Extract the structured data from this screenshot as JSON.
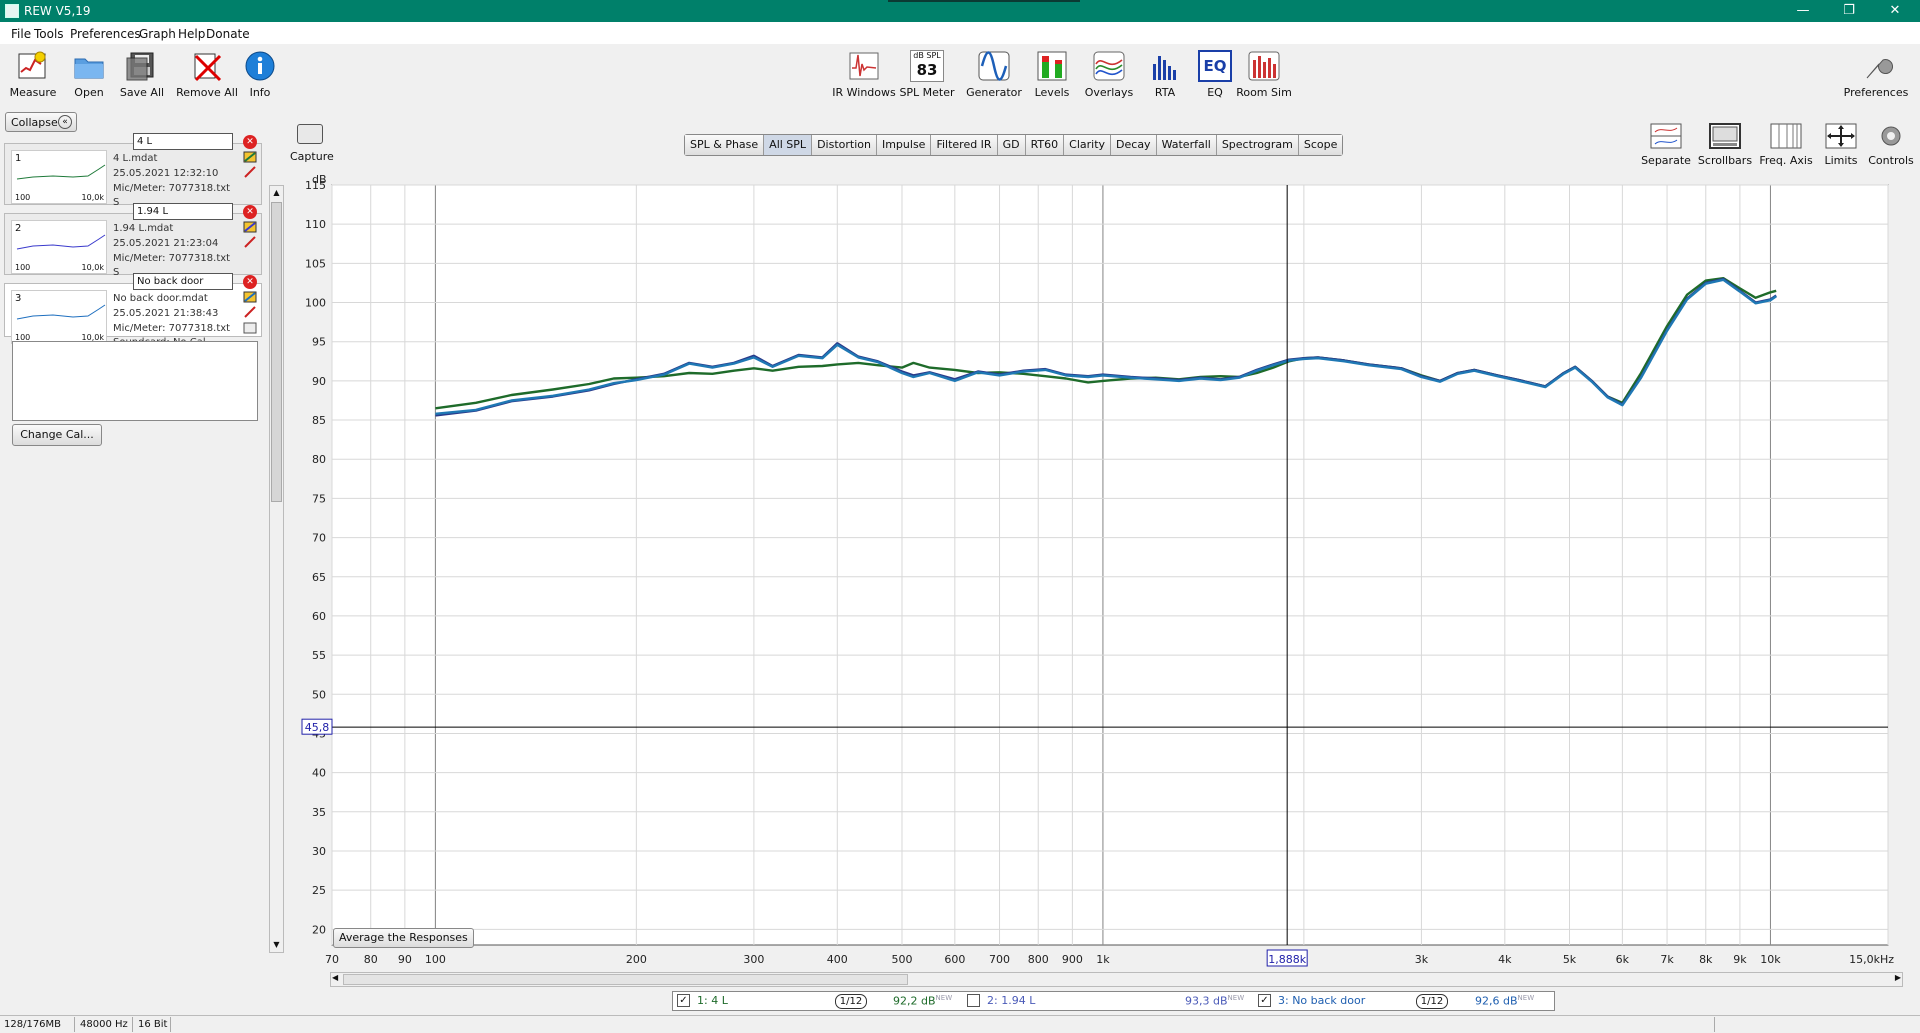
{
  "window": {
    "title": "REW V5,19"
  },
  "menu": [
    "File",
    "Tools",
    "Preferences",
    "Graph",
    "Help",
    "Donate"
  ],
  "toolbar": {
    "left": [
      {
        "label": "Measure",
        "icon": "measure-icon"
      },
      {
        "label": "Open",
        "icon": "folder-icon"
      },
      {
        "label": "Save All",
        "icon": "floppy-icon"
      },
      {
        "label": "Remove All",
        "icon": "remove-all-icon"
      },
      {
        "label": "Info",
        "icon": "info-icon"
      }
    ],
    "center": [
      {
        "label": "IR Windows",
        "icon": "ir-windows-icon"
      },
      {
        "label": "SPL Meter",
        "icon": "spl-meter-icon",
        "top_text": "dB SPL",
        "value": "83"
      },
      {
        "label": "Generator",
        "icon": "generator-icon"
      },
      {
        "label": "Levels",
        "icon": "levels-icon"
      },
      {
        "label": "Overlays",
        "icon": "overlays-icon"
      },
      {
        "label": "RTA",
        "icon": "rta-icon"
      },
      {
        "label": "EQ",
        "icon": "eq-icon",
        "text": "EQ"
      },
      {
        "label": "Room Sim",
        "icon": "room-sim-icon"
      }
    ],
    "right": {
      "label": "Preferences",
      "icon": "wrench-icon"
    }
  },
  "left_panel": {
    "collapse_label": "Collapse",
    "measurements": [
      {
        "num": "1",
        "name": "4 L",
        "file": "4 L.mdat",
        "date": "25.05.2021 12:32:10",
        "mic": "Mic/Meter: 7077318.txt",
        "soundcard": "S",
        "color": "#1f7a3a",
        "thumb_low": "100",
        "thumb_high": "10,0k"
      },
      {
        "num": "2",
        "name": "1.94 L",
        "file": "1.94 L.mdat",
        "date": "25.05.2021 21:23:04",
        "mic": "Mic/Meter: 7077318.txt",
        "soundcard": "S",
        "color": "#3a3acc",
        "thumb_low": "100",
        "thumb_high": "10,0k"
      },
      {
        "num": "3",
        "name": "No back door",
        "file": "No back door.mdat",
        "date": "25.05.2021 21:38:43",
        "mic": "Mic/Meter: 7077318.txt",
        "soundcard": "Soundcard: No Cal",
        "color": "#1e6fbf",
        "thumb_low": "100",
        "thumb_high": "10,0k"
      }
    ],
    "change_cal_label": "Change Cal..."
  },
  "graph_toolbar": {
    "capture_label": "Capture",
    "tabs": [
      "SPL & Phase",
      "All SPL",
      "Distortion",
      "Impulse",
      "Filtered IR",
      "GD",
      "RT60",
      "Clarity",
      "Decay",
      "Waterfall",
      "Spectrogram",
      "Scope"
    ],
    "active_tab": "All SPL",
    "right_buttons": [
      {
        "label": "Separate",
        "icon": "separate-icon"
      },
      {
        "label": "Scrollbars",
        "icon": "scrollbars-icon"
      },
      {
        "label": "Freq. Axis",
        "icon": "freq-axis-icon"
      },
      {
        "label": "Limits",
        "icon": "limits-icon"
      },
      {
        "label": "Controls",
        "icon": "gear-icon"
      }
    ]
  },
  "chart_data": {
    "type": "line",
    "ylabel": "dB",
    "xlabel": "",
    "x_unit_label": "Hz",
    "x_scale": "log",
    "xlim": [
      70,
      15000
    ],
    "ylim": [
      18,
      115
    ],
    "y_ticks": [
      20,
      25,
      30,
      35,
      40,
      45,
      50,
      55,
      60,
      65,
      70,
      75,
      80,
      85,
      90,
      95,
      100,
      105,
      110,
      115
    ],
    "x_ticks": [
      {
        "v": 70,
        "label": "70"
      },
      {
        "v": 80,
        "label": "80"
      },
      {
        "v": 90,
        "label": "90"
      },
      {
        "v": 100,
        "label": "100"
      },
      {
        "v": 200,
        "label": "200"
      },
      {
        "v": 300,
        "label": "300"
      },
      {
        "v": 400,
        "label": "400"
      },
      {
        "v": 500,
        "label": "500"
      },
      {
        "v": 600,
        "label": "600"
      },
      {
        "v": 700,
        "label": "700"
      },
      {
        "v": 800,
        "label": "800"
      },
      {
        "v": 900,
        "label": "900"
      },
      {
        "v": 1000,
        "label": "1k"
      },
      {
        "v": 3000,
        "label": "3k"
      },
      {
        "v": 4000,
        "label": "4k"
      },
      {
        "v": 5000,
        "label": "5k"
      },
      {
        "v": 6000,
        "label": "6k"
      },
      {
        "v": 7000,
        "label": "7k"
      },
      {
        "v": 8000,
        "label": "8k"
      },
      {
        "v": 9000,
        "label": "9k"
      },
      {
        "v": 10000,
        "label": "10k"
      },
      {
        "v": 15000,
        "label": "15,0kHz"
      }
    ],
    "cursor": {
      "x": 1888,
      "y": 45.8,
      "x_label": "1,888k",
      "y_label": "45,8"
    },
    "grid": true,
    "series": [
      {
        "name": "4 L",
        "color": "#1e6b2a",
        "points": [
          [
            100,
            86.5
          ],
          [
            115,
            87.2
          ],
          [
            130,
            88.2
          ],
          [
            150,
            88.9
          ],
          [
            170,
            89.6
          ],
          [
            185,
            90.3
          ],
          [
            200,
            90.4
          ],
          [
            220,
            90.6
          ],
          [
            240,
            91.0
          ],
          [
            260,
            90.9
          ],
          [
            280,
            91.3
          ],
          [
            300,
            91.6
          ],
          [
            320,
            91.3
          ],
          [
            350,
            91.8
          ],
          [
            380,
            91.9
          ],
          [
            400,
            92.1
          ],
          [
            430,
            92.3
          ],
          [
            460,
            92.0
          ],
          [
            500,
            91.7
          ],
          [
            520,
            92.3
          ],
          [
            550,
            91.7
          ],
          [
            600,
            91.4
          ],
          [
            650,
            91.0
          ],
          [
            700,
            91.1
          ],
          [
            760,
            90.9
          ],
          [
            820,
            90.6
          ],
          [
            880,
            90.3
          ],
          [
            950,
            89.8
          ],
          [
            1000,
            90.0
          ],
          [
            1100,
            90.3
          ],
          [
            1200,
            90.4
          ],
          [
            1300,
            90.2
          ],
          [
            1400,
            90.5
          ],
          [
            1500,
            90.6
          ],
          [
            1600,
            90.5
          ],
          [
            1700,
            91.0
          ],
          [
            1800,
            91.7
          ],
          [
            1900,
            92.5
          ],
          [
            2000,
            92.9
          ],
          [
            2100,
            93.0
          ],
          [
            2300,
            92.6
          ],
          [
            2500,
            92.1
          ],
          [
            2800,
            91.6
          ],
          [
            3000,
            90.7
          ],
          [
            3200,
            90.0
          ],
          [
            3400,
            91.0
          ],
          [
            3600,
            91.4
          ],
          [
            3900,
            90.7
          ],
          [
            4200,
            90.1
          ],
          [
            4600,
            89.3
          ],
          [
            4900,
            91.0
          ],
          [
            5100,
            91.8
          ],
          [
            5400,
            90.0
          ],
          [
            5700,
            88.0
          ],
          [
            6000,
            87.2
          ],
          [
            6400,
            91.0
          ],
          [
            7000,
            97.0
          ],
          [
            7500,
            101.0
          ],
          [
            8000,
            102.8
          ],
          [
            8500,
            103.1
          ],
          [
            9000,
            101.8
          ],
          [
            9500,
            100.6
          ],
          [
            10000,
            101.3
          ],
          [
            10200,
            101.5
          ]
        ]
      },
      {
        "name": "1.94 L",
        "color": "#2a3a8a",
        "points": [
          [
            100,
            85.6
          ],
          [
            115,
            86.2
          ],
          [
            130,
            87.4
          ],
          [
            150,
            88.0
          ],
          [
            170,
            88.8
          ],
          [
            185,
            89.6
          ],
          [
            200,
            90.2
          ],
          [
            220,
            90.9
          ],
          [
            240,
            92.3
          ],
          [
            260,
            91.8
          ],
          [
            280,
            92.3
          ],
          [
            300,
            93.2
          ],
          [
            320,
            91.9
          ],
          [
            350,
            93.3
          ],
          [
            380,
            93.0
          ],
          [
            400,
            94.8
          ],
          [
            430,
            93.1
          ],
          [
            460,
            92.5
          ],
          [
            500,
            91.2
          ],
          [
            520,
            90.7
          ],
          [
            550,
            91.1
          ],
          [
            600,
            90.2
          ],
          [
            650,
            91.2
          ],
          [
            700,
            90.8
          ],
          [
            760,
            91.3
          ],
          [
            820,
            91.5
          ],
          [
            880,
            90.8
          ],
          [
            950,
            90.6
          ],
          [
            1000,
            90.8
          ],
          [
            1100,
            90.5
          ],
          [
            1200,
            90.3
          ],
          [
            1300,
            90.1
          ],
          [
            1400,
            90.4
          ],
          [
            1500,
            90.2
          ],
          [
            1600,
            90.5
          ],
          [
            1700,
            91.4
          ],
          [
            1800,
            92.1
          ],
          [
            1900,
            92.7
          ],
          [
            2000,
            92.9
          ],
          [
            2100,
            93.0
          ],
          [
            2300,
            92.6
          ],
          [
            2500,
            92.1
          ],
          [
            2800,
            91.6
          ],
          [
            3000,
            90.6
          ],
          [
            3200,
            90.0
          ],
          [
            3400,
            91.0
          ],
          [
            3600,
            91.4
          ],
          [
            3900,
            90.7
          ],
          [
            4200,
            90.1
          ],
          [
            4600,
            89.3
          ],
          [
            4900,
            91.0
          ],
          [
            5100,
            91.8
          ],
          [
            5400,
            90.0
          ],
          [
            5700,
            88.0
          ],
          [
            6000,
            87.0
          ],
          [
            6400,
            90.5
          ],
          [
            7000,
            96.5
          ],
          [
            7500,
            100.5
          ],
          [
            8000,
            102.5
          ],
          [
            8500,
            103.0
          ],
          [
            9000,
            101.5
          ],
          [
            9500,
            100.0
          ],
          [
            10000,
            100.4
          ],
          [
            10200,
            100.9
          ]
        ]
      },
      {
        "name": "No back door",
        "color": "#1f78b4",
        "points": [
          [
            100,
            85.8
          ],
          [
            115,
            86.3
          ],
          [
            130,
            87.5
          ],
          [
            150,
            88.1
          ],
          [
            170,
            88.9
          ],
          [
            185,
            89.7
          ],
          [
            200,
            90.1
          ],
          [
            220,
            90.8
          ],
          [
            240,
            92.2
          ],
          [
            260,
            91.7
          ],
          [
            280,
            92.2
          ],
          [
            300,
            93.0
          ],
          [
            320,
            91.8
          ],
          [
            350,
            93.2
          ],
          [
            380,
            92.9
          ],
          [
            400,
            94.6
          ],
          [
            430,
            93.0
          ],
          [
            460,
            92.4
          ],
          [
            500,
            91.0
          ],
          [
            520,
            90.5
          ],
          [
            550,
            91.0
          ],
          [
            600,
            90.0
          ],
          [
            650,
            91.1
          ],
          [
            700,
            90.7
          ],
          [
            760,
            91.2
          ],
          [
            820,
            91.4
          ],
          [
            880,
            90.7
          ],
          [
            950,
            90.5
          ],
          [
            1000,
            90.7
          ],
          [
            1100,
            90.4
          ],
          [
            1200,
            90.2
          ],
          [
            1300,
            90.0
          ],
          [
            1400,
            90.3
          ],
          [
            1500,
            90.1
          ],
          [
            1600,
            90.4
          ],
          [
            1700,
            91.3
          ],
          [
            1800,
            92.0
          ],
          [
            1900,
            92.6
          ],
          [
            2000,
            92.8
          ],
          [
            2100,
            92.9
          ],
          [
            2300,
            92.5
          ],
          [
            2500,
            92.0
          ],
          [
            2800,
            91.5
          ],
          [
            3000,
            90.5
          ],
          [
            3200,
            89.9
          ],
          [
            3400,
            90.9
          ],
          [
            3600,
            91.3
          ],
          [
            3900,
            90.6
          ],
          [
            4200,
            90.0
          ],
          [
            4600,
            89.2
          ],
          [
            4900,
            90.9
          ],
          [
            5100,
            91.7
          ],
          [
            5400,
            89.9
          ],
          [
            5700,
            87.9
          ],
          [
            6000,
            86.9
          ],
          [
            6400,
            90.4
          ],
          [
            7000,
            96.4
          ],
          [
            7500,
            100.4
          ],
          [
            8000,
            102.4
          ],
          [
            8500,
            102.9
          ],
          [
            9000,
            101.4
          ],
          [
            9500,
            99.9
          ],
          [
            10000,
            100.3
          ],
          [
            10200,
            100.8
          ]
        ]
      }
    ]
  },
  "graph": {
    "average_label": "Average the Responses"
  },
  "legend": [
    {
      "checked": true,
      "label": "1: 4 L",
      "smoothing": "1/12",
      "value": "92,2 dB",
      "tag": "NEW",
      "color": "#1e6b2a"
    },
    {
      "checked": false,
      "label": "2: 1.94 L",
      "smoothing": "",
      "value": "93,3 dB",
      "tag": "NEW",
      "color": "#4a5ab8"
    },
    {
      "checked": true,
      "label": "3: No back door",
      "smoothing": "1/12",
      "value": "92,6 dB",
      "tag": "NEW",
      "color": "#1f5fb0"
    }
  ],
  "statusbar": [
    "128/176MB",
    "48000 Hz",
    "16 Bit"
  ]
}
